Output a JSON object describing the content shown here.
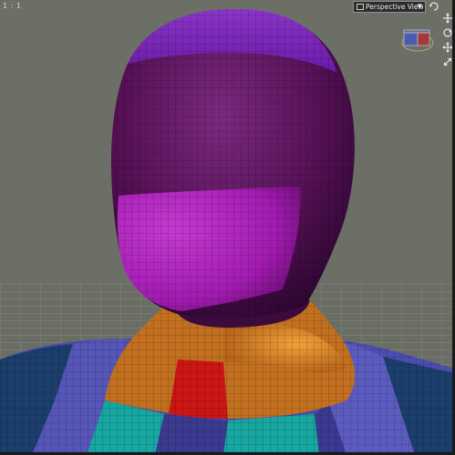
{
  "viewport": {
    "coordinate_readout": "1 : 1",
    "view_dropdown": {
      "label": "Perspective View",
      "arrow": "▼"
    }
  },
  "toolbar": {
    "icons": [
      "camera-rotate-icon",
      "move-icon",
      "rotate-icon",
      "pan-icon",
      "scale-icon"
    ]
  },
  "colors": {
    "background": "#6c6f66",
    "floor_grid": "#9a9d94",
    "head_purple": "#5a0d5e",
    "cap_violet": "#7a22b8",
    "face_magenta": "#a21bb0",
    "neck_orange": "#c8761d",
    "chest_red": "#c71616",
    "chest_teal": "#17a6a0",
    "shoulder_blue": "#5a5ab0",
    "dark_blue": "#1b3e6c"
  }
}
